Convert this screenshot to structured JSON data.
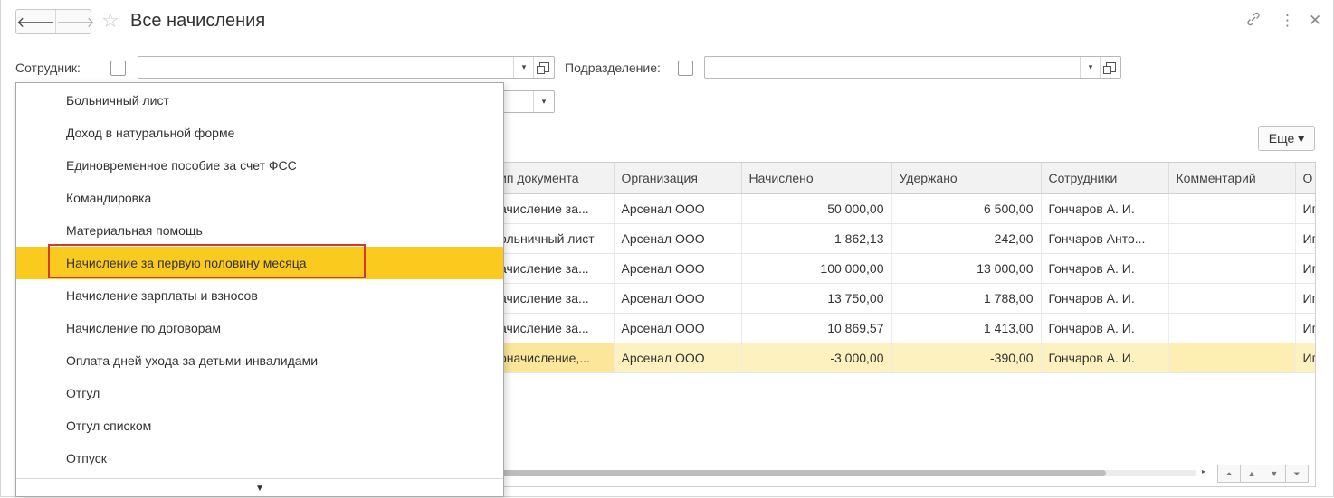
{
  "header": {
    "title": "Все начисления",
    "back_glyph": "🡐",
    "forward_glyph": "🡒",
    "star_glyph": "☆",
    "link_glyph": "🔗",
    "menu_glyph": "⋮",
    "close_glyph": "✕"
  },
  "filters": {
    "employee_label": "Сотрудник:",
    "employee_value": "",
    "department_label": "Подразделение:",
    "department_value": "",
    "dropdown_glyph": "▾"
  },
  "toolbar": {
    "more_label": "Еще ▾"
  },
  "table": {
    "columns": [
      "ип документа",
      "Организация",
      "Начислено",
      "Удержано",
      "Сотрудники",
      "Комментарий",
      "О"
    ],
    "rows": [
      {
        "doc_type": "ачисление за...",
        "org": "Арсенал ООО",
        "accrued": "50 000,00",
        "withheld": "6 500,00",
        "employees": "Гончаров А. И.",
        "comment": "",
        "last": "Иг"
      },
      {
        "doc_type": "ольничный лист",
        "org": "Арсенал ООО",
        "accrued": "1 862,13",
        "withheld": "242,00",
        "employees": "Гончаров Анто...",
        "comment": "",
        "last": "Иг"
      },
      {
        "doc_type": "ачисление за...",
        "org": "Арсенал ООО",
        "accrued": "100 000,00",
        "withheld": "13 000,00",
        "employees": "Гончаров А. И.",
        "comment": "",
        "last": "Иг"
      },
      {
        "doc_type": "ачисление за...",
        "org": "Арсенал ООО",
        "accrued": "13 750,00",
        "withheld": "1 788,00",
        "employees": "Гончаров А. И.",
        "comment": "",
        "last": "Иг"
      },
      {
        "doc_type": "ачисление за...",
        "org": "Арсенал ООО",
        "accrued": "10 869,57",
        "withheld": "1 413,00",
        "employees": "Гончаров А. И.",
        "comment": "",
        "last": "Иг"
      },
      {
        "doc_type": "оначисление,...",
        "org": "Арсенал ООО",
        "accrued": "-3 000,00",
        "withheld": "-390,00",
        "employees": "Гончаров А. И.",
        "comment": "",
        "last": "Иг"
      }
    ]
  },
  "dropdown": {
    "items": [
      "Больничный лист",
      "Доход в натуральной форме",
      "Единовременное пособие за счет ФСС",
      "Командировка",
      "Материальная помощь",
      "Начисление за первую половину месяца",
      "Начисление зарплаты и взносов",
      "Начисление по договорам",
      "Оплата дней ухода за детьми-инвалидами",
      "Отгул",
      "Отгул списком",
      "Отпуск"
    ],
    "selected_index": 5,
    "scroll_down_glyph": "▼"
  },
  "pager": {
    "first_glyph": "⏶",
    "up_glyph": "▲",
    "down_glyph": "▼",
    "last_glyph": "⏷",
    "scroll_right_glyph": "▸"
  },
  "colors": {
    "selection": "#fbca1e",
    "highlight_border": "#d23b2f",
    "current_row": "#fdf1c0"
  }
}
